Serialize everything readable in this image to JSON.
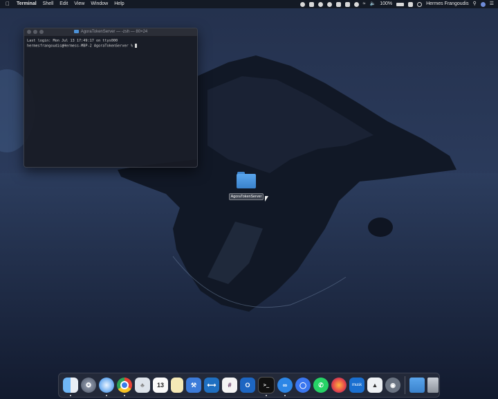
{
  "menubar": {
    "app": "Terminal",
    "menus": [
      "Shell",
      "Edit",
      "View",
      "Window",
      "Help"
    ],
    "battery": "100%",
    "user": "Hermes Frangoudis"
  },
  "terminal": {
    "title": "AgoraTokenServer — -zsh — 80×24",
    "lines": [
      "Last login: Mon Jul 13 17:49:17 on ttys000",
      "hermesfrangoudis@Hermess-MBP-2 AgoraTokenServer % "
    ]
  },
  "desktop": {
    "folder_label": "AgoraTokenServer"
  },
  "dock": {
    "icons": [
      "finder-icon",
      "launchpad-icon",
      "safari-icon",
      "chrome-icon",
      "teeth-icon",
      "calendar-icon",
      "notes-icon",
      "xcode-icon",
      "vscode-icon",
      "slack-icon",
      "outlook-icon",
      "terminal-icon",
      "infinity-app-icon",
      "signal-icon",
      "whatsapp-icon",
      "firefox-icon",
      "musk-app-icon",
      "unity-icon",
      "screenshot-icon",
      "downloads-folder-icon",
      "trash-icon"
    ],
    "musk_label": "musk",
    "calendar_day": "13"
  }
}
